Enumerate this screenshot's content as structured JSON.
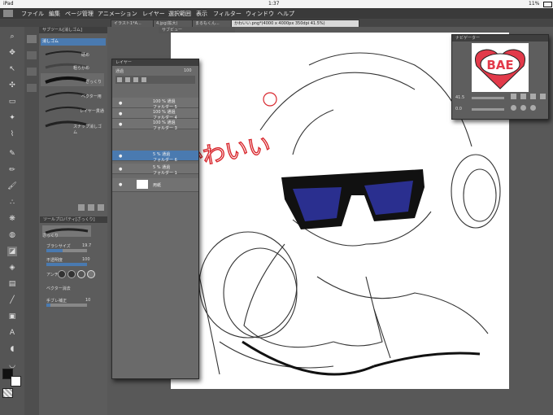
{
  "status": {
    "device": "iPad",
    "time": "1:37",
    "battery": "11%"
  },
  "menu": [
    "ファイル",
    "編集",
    "ページ管理",
    "アニメーション",
    "レイヤー",
    "選択範囲",
    "表示",
    "フィルター",
    "ウィンドウ",
    "ヘルプ"
  ],
  "tabs": [
    "イラスト1*A...",
    "4.jpg(拡大)",
    "まるもくん...",
    "かわいい.png*(4000 x 4000px 350dpi 41.5%)"
  ],
  "subtool": {
    "title": "サブツール[消しゴム]",
    "items": [
      "消しゴム",
      "硬め",
      "粗らかめ",
      "ざっくり",
      "ベクター用",
      "レイヤー貫通",
      "スナップ消しゴム"
    ]
  },
  "toolprop": {
    "title": "ツールプロパティ[ざっくり]",
    "name": "ざっくり",
    "brush_size_label": "ブラシサイズ",
    "brush_size": "19.7",
    "opacity_label": "不透明度",
    "opacity": "100",
    "aa_label": "アンチ",
    "vector_label": "ベクター消去",
    "stabilize_label": "手ブレ補正",
    "stabilize": "10"
  },
  "subview": {
    "title": "サブビュー"
  },
  "layers": {
    "title": "レイヤー",
    "blend": "通過",
    "opacity": "100",
    "rows": [
      {
        "text": "100 % 通過\nフォルダー 5",
        "selected": false
      },
      {
        "text": "100 % 通過\nフォルダー 4",
        "selected": false
      },
      {
        "text": "100 % 通過\nフォルダー 3",
        "selected": false
      },
      {
        "text": "5 % 通過\nフォルダー 6",
        "selected": true
      },
      {
        "text": "5 % 通過\nフォルダー 1",
        "selected": false
      },
      {
        "text": "用紙",
        "selected": false
      }
    ]
  },
  "navigator": {
    "title": "ナビゲーター",
    "zoom": "41.5",
    "angle": "0.0",
    "thumb_text": "BAE"
  },
  "canvas": {
    "caption": "#かわいい"
  },
  "colors": {
    "accent": "#4a7ab0",
    "caption": "#d8262c",
    "heart": "#e23a4a",
    "lens": "#2a2f8f"
  }
}
